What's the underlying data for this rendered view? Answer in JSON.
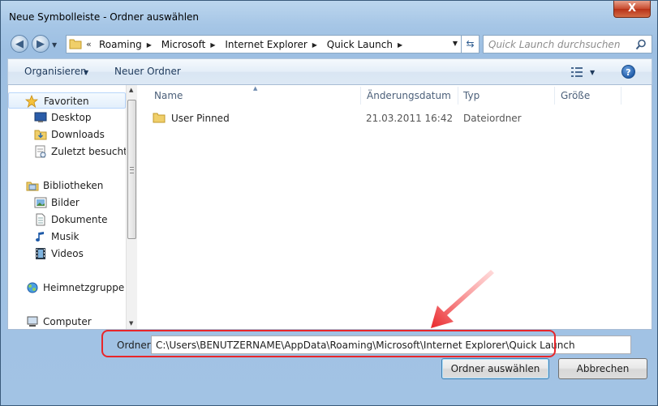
{
  "window": {
    "title": "Neue Symbolleiste - Ordner auswählen",
    "close_label": "X"
  },
  "address_bar": {
    "overflow_chevron": "«",
    "breadcrumbs": [
      "Roaming",
      "Microsoft",
      "Internet Explorer",
      "Quick Launch"
    ],
    "search_placeholder": "Quick Launch durchsuchen"
  },
  "toolbar": {
    "organize_label": "Organisieren",
    "new_folder_label": "Neuer Ordner",
    "help_label": "?"
  },
  "nav_pane": {
    "favorites_label": "Favoriten",
    "favorites": [
      "Desktop",
      "Downloads",
      "Zuletzt besucht"
    ],
    "libraries_label": "Bibliotheken",
    "libraries": [
      "Bilder",
      "Dokumente",
      "Musik",
      "Videos"
    ],
    "homegroup_label": "Heimnetzgruppe",
    "computer_label": "Computer"
  },
  "file_list": {
    "columns": [
      "Name",
      "Änderungsdatum",
      "Typ",
      "Größe"
    ],
    "rows": [
      {
        "name": "User Pinned",
        "date": "21.03.2011 16:42",
        "type": "Dateiordner",
        "size": ""
      }
    ]
  },
  "folder_field": {
    "label": "Ordner:",
    "value": "C:\\Users\\BENUTZERNAME\\AppData\\Roaming\\Microsoft\\Internet Explorer\\Quick Launch"
  },
  "buttons": {
    "select_folder": "Ordner auswählen",
    "cancel": "Abbrechen"
  },
  "colors": {
    "annotation_red": "#e8262a",
    "window_frame": "#a2c3e4"
  }
}
